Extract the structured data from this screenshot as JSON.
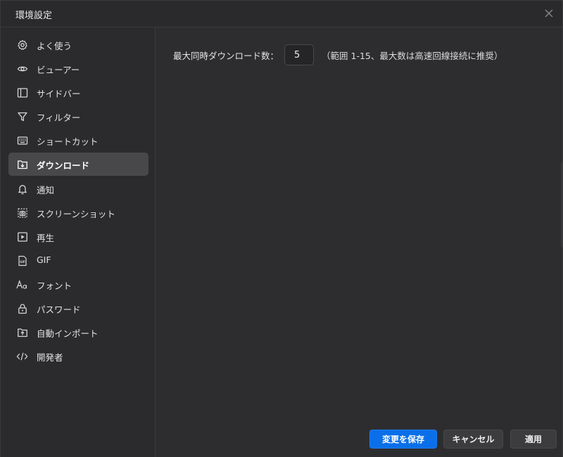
{
  "window": {
    "title": "環境設定"
  },
  "sidebar": {
    "items": [
      {
        "label": "よく使う",
        "icon": "gear-icon"
      },
      {
        "label": "ビューアー",
        "icon": "eye-icon"
      },
      {
        "label": "サイドバー",
        "icon": "sidebar-icon"
      },
      {
        "label": "フィルター",
        "icon": "filter-icon"
      },
      {
        "label": "ショートカット",
        "icon": "keyboard-icon"
      },
      {
        "label": "ダウンロード",
        "icon": "download-folder-icon",
        "active": true
      },
      {
        "label": "通知",
        "icon": "bell-icon"
      },
      {
        "label": "スクリーンショット",
        "icon": "screenshot-icon"
      },
      {
        "label": "再生",
        "icon": "play-icon"
      },
      {
        "label": "GIF",
        "icon": "gif-file-icon"
      },
      {
        "label": "フォント",
        "icon": "font-icon"
      },
      {
        "label": "パスワード",
        "icon": "lock-icon"
      },
      {
        "label": "自動インポート",
        "icon": "import-folder-icon"
      },
      {
        "label": "開発者",
        "icon": "code-icon"
      }
    ]
  },
  "main": {
    "max_downloads_label": "最大同時ダウンロード数：",
    "max_downloads_value": "5",
    "max_downloads_hint": "（範囲 1-15、最大数は高速回線接続に推奨）"
  },
  "footer": {
    "save_label": "変更を保存",
    "cancel_label": "キャンセル",
    "apply_label": "適用"
  },
  "colors": {
    "accent": "#0a6fe8",
    "background": "#2b2b2d",
    "active_item": "#48484b"
  }
}
